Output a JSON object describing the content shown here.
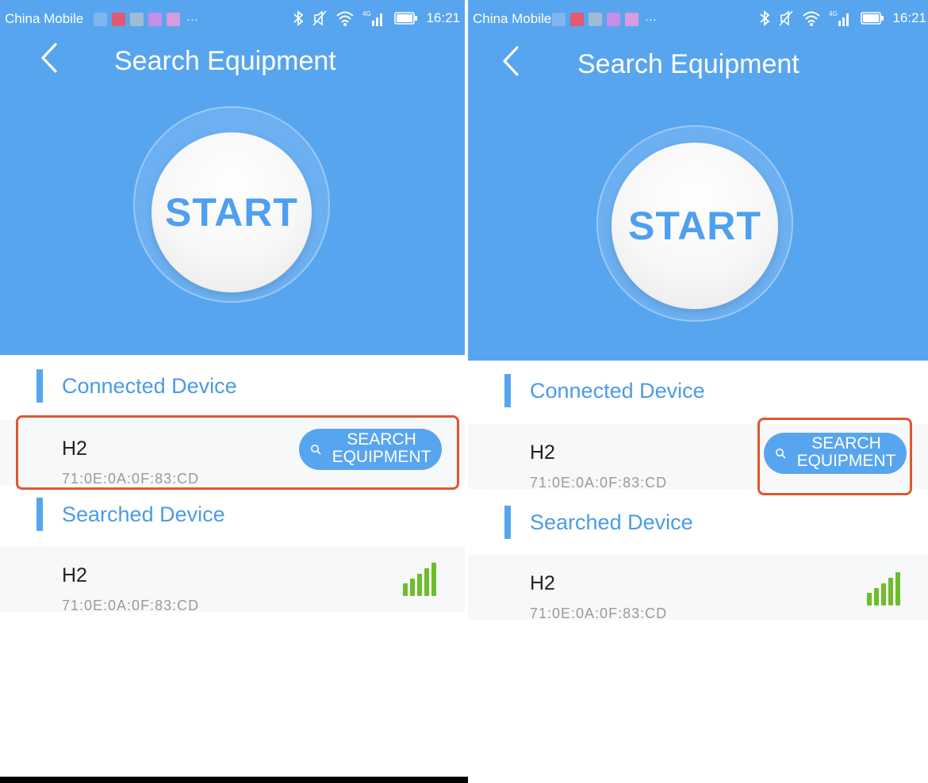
{
  "colors": {
    "header": "#58a5ef",
    "accent_text": "#4a9be8",
    "signal": "#6cbe2b",
    "highlight": "#e0572f"
  },
  "icons": {
    "back": "chevron-left-icon",
    "search": "search-icon",
    "signal": "signal-strength-icon"
  },
  "left": {
    "status_bar": {
      "carrier": "China Mobile",
      "more": "···",
      "time": "16:21",
      "network": "4G"
    },
    "title": "Search Equipment",
    "start_label": "START",
    "connected_section": "Connected Device",
    "connected_device": {
      "name": "H2",
      "mac": "71:0E:0A:0F:83:CD"
    },
    "search_button": {
      "line1": "SEARCH",
      "line2": "EQUIPMENT"
    },
    "searched_section": "Searched Device",
    "searched_device": {
      "name": "H2",
      "mac": "71:0E:0A:0F:83:CD",
      "signal_level": 5
    }
  },
  "right": {
    "status_bar": {
      "carrier": "China Mobile",
      "more": "···",
      "time": "16:21",
      "network": "4G"
    },
    "title": "Search Equipment",
    "start_label": "START",
    "connected_section": "Connected Device",
    "connected_device": {
      "name": "H2",
      "mac": "71:0E:0A:0F:83:CD"
    },
    "search_button": {
      "line1": "SEARCH",
      "line2": "EQUIPMENT"
    },
    "searched_section": "Searched Device",
    "searched_device": {
      "name": "H2",
      "mac": "71:0E:0A:0F:83:CD",
      "signal_level": 5
    }
  }
}
